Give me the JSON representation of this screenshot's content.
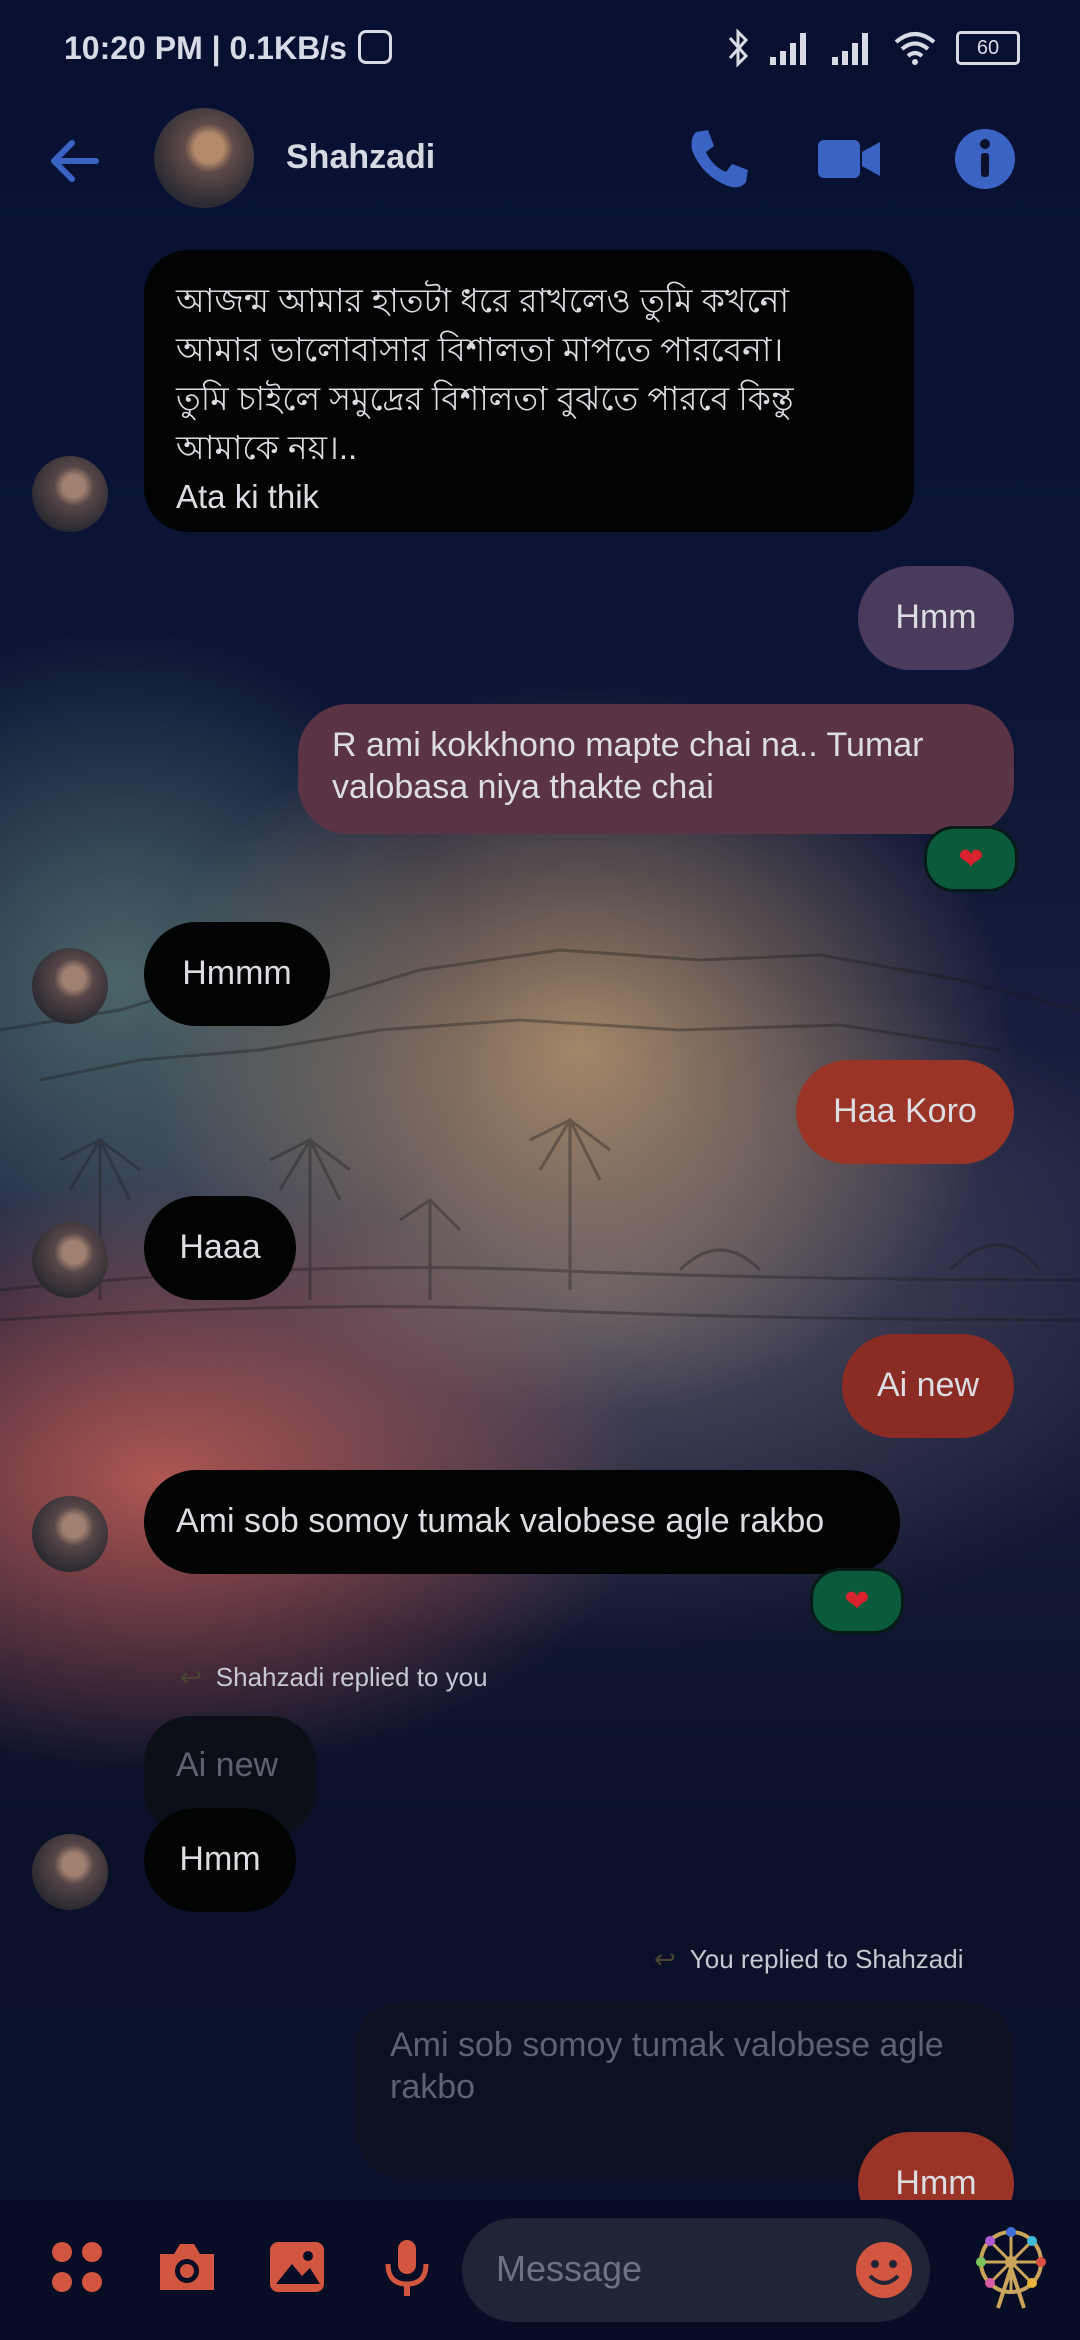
{
  "status_bar": {
    "time": "10:20 PM | 0.1KB/s",
    "battery": "60"
  },
  "header": {
    "contact_name": "Shahzadi"
  },
  "messages": [
    {
      "text_lines": [
        "আজন্ম আমার হাতটা ধরে রাখলেও তুমি কখনো",
        "আমার ভালোবাসার বিশালতা মাপতে পারবেনা।",
        "তুমি চাইলে সমুদ্রের বিশালতা বুঝতে পারবে কিন্তু",
        "আমাকে নয়।..",
        "Ata ki thik"
      ]
    },
    {
      "text": "Hmm"
    },
    {
      "text": "R ami kokkhono mapte chai na..  Tumar valobasa niya thakte chai"
    },
    {
      "text": "Hmmm"
    },
    {
      "text": "Haa Koro"
    },
    {
      "text": "Haaa"
    },
    {
      "text": "Ai new"
    },
    {
      "text": "Ami sob somoy tumak valobese agle rakbo"
    },
    {
      "quote": "Ai new",
      "text": "Hmm"
    },
    {
      "quote": "Ami sob somoy tumak valobese agle rakbo",
      "text": "Hmm"
    }
  ],
  "reply_labels": {
    "incoming": "Shahzadi replied to you",
    "outgoing": "You replied to Shahzadi"
  },
  "reactions": {
    "heart": "❤"
  },
  "composer": {
    "placeholder": "Message"
  },
  "colors": {
    "accent": "#3a63c4",
    "reaction_bg": "#0a5a3c",
    "composer_icons": "#d2553f"
  }
}
